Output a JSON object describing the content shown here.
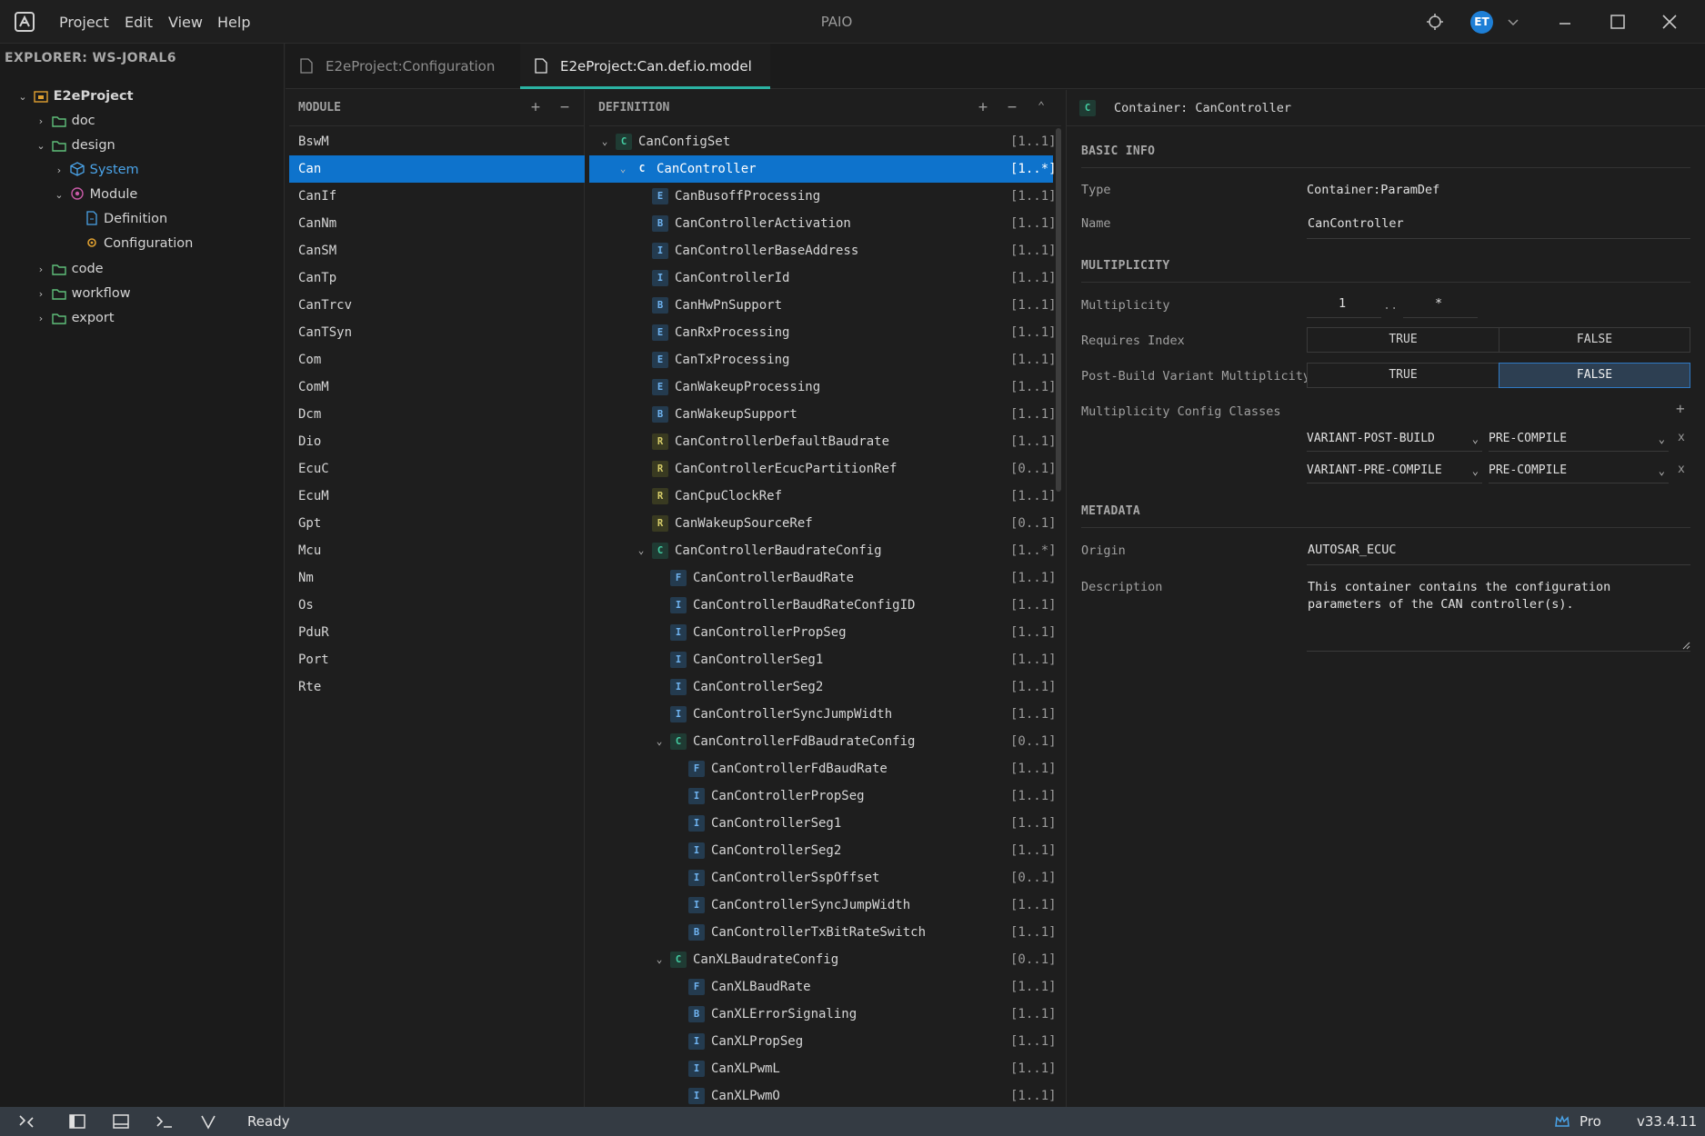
{
  "titlebar": {
    "menu": [
      "Project",
      "Edit",
      "View",
      "Help"
    ],
    "app_title": "PAIO",
    "user_initials": "ET"
  },
  "sidebar": {
    "title": "EXPLORER: WS-JORAL6",
    "items": [
      {
        "label": "E2eProject"
      },
      {
        "label": "doc"
      },
      {
        "label": "design"
      },
      {
        "label": "System"
      },
      {
        "label": "Module"
      },
      {
        "label": "Definition"
      },
      {
        "label": "Configuration"
      },
      {
        "label": "code"
      },
      {
        "label": "workflow"
      },
      {
        "label": "export"
      }
    ]
  },
  "tabs": [
    {
      "label": "E2eProject:Configuration"
    },
    {
      "label": "E2eProject:Can.def.io.model"
    }
  ],
  "module_panel": {
    "title": "MODULE",
    "selected": "Can",
    "items": [
      "BswM",
      "Can",
      "CanIf",
      "CanNm",
      "CanSM",
      "CanTp",
      "CanTrcv",
      "CanTSyn",
      "Com",
      "ComM",
      "Dcm",
      "Dio",
      "EcuC",
      "EcuM",
      "Gpt",
      "Mcu",
      "Nm",
      "Os",
      "PduR",
      "Port",
      "Rte"
    ]
  },
  "definition_panel": {
    "title": "DEFINITION",
    "rows": [
      {
        "type": "C",
        "label": "CanConfigSet",
        "mult": "[1..1]"
      },
      {
        "type": "C",
        "label": "CanController",
        "mult": "[1..*]"
      },
      {
        "type": "E",
        "label": "CanBusoffProcessing",
        "mult": "[1..1]"
      },
      {
        "type": "B",
        "label": "CanControllerActivation",
        "mult": "[1..1]"
      },
      {
        "type": "I",
        "label": "CanControllerBaseAddress",
        "mult": "[1..1]"
      },
      {
        "type": "I",
        "label": "CanControllerId",
        "mult": "[1..1]"
      },
      {
        "type": "B",
        "label": "CanHwPnSupport",
        "mult": "[1..1]"
      },
      {
        "type": "E",
        "label": "CanRxProcessing",
        "mult": "[1..1]"
      },
      {
        "type": "E",
        "label": "CanTxProcessing",
        "mult": "[1..1]"
      },
      {
        "type": "E",
        "label": "CanWakeupProcessing",
        "mult": "[1..1]"
      },
      {
        "type": "B",
        "label": "CanWakeupSupport",
        "mult": "[1..1]"
      },
      {
        "type": "R",
        "label": "CanControllerDefaultBaudrate",
        "mult": "[1..1]"
      },
      {
        "type": "R",
        "label": "CanControllerEcucPartitionRef",
        "mult": "[0..1]"
      },
      {
        "type": "R",
        "label": "CanCpuClockRef",
        "mult": "[1..1]"
      },
      {
        "type": "R",
        "label": "CanWakeupSourceRef",
        "mult": "[0..1]"
      },
      {
        "type": "C",
        "label": "CanControllerBaudrateConfig",
        "mult": "[1..*]"
      },
      {
        "type": "F",
        "label": "CanControllerBaudRate",
        "mult": "[1..1]"
      },
      {
        "type": "I",
        "label": "CanControllerBaudRateConfigID",
        "mult": "[1..1]"
      },
      {
        "type": "I",
        "label": "CanControllerPropSeg",
        "mult": "[1..1]"
      },
      {
        "type": "I",
        "label": "CanControllerSeg1",
        "mult": "[1..1]"
      },
      {
        "type": "I",
        "label": "CanControllerSeg2",
        "mult": "[1..1]"
      },
      {
        "type": "I",
        "label": "CanControllerSyncJumpWidth",
        "mult": "[1..1]"
      },
      {
        "type": "C",
        "label": "CanControllerFdBaudrateConfig",
        "mult": "[0..1]"
      },
      {
        "type": "F",
        "label": "CanControllerFdBaudRate",
        "mult": "[1..1]"
      },
      {
        "type": "I",
        "label": "CanControllerPropSeg",
        "mult": "[1..1]"
      },
      {
        "type": "I",
        "label": "CanControllerSeg1",
        "mult": "[1..1]"
      },
      {
        "type": "I",
        "label": "CanControllerSeg2",
        "mult": "[1..1]"
      },
      {
        "type": "I",
        "label": "CanControllerSspOffset",
        "mult": "[0..1]"
      },
      {
        "type": "I",
        "label": "CanControllerSyncJumpWidth",
        "mult": "[1..1]"
      },
      {
        "type": "B",
        "label": "CanControllerTxBitRateSwitch",
        "mult": "[1..1]"
      },
      {
        "type": "C",
        "label": "CanXLBaudrateConfig",
        "mult": "[0..1]"
      },
      {
        "type": "F",
        "label": "CanXLBaudRate",
        "mult": "[1..1]"
      },
      {
        "type": "B",
        "label": "CanXLErrorSignaling",
        "mult": "[1..1]"
      },
      {
        "type": "I",
        "label": "CanXLPropSeg",
        "mult": "[1..1]"
      },
      {
        "type": "I",
        "label": "CanXLPwmL",
        "mult": "[1..1]"
      },
      {
        "type": "I",
        "label": "CanXLPwmO",
        "mult": "[1..1]"
      }
    ]
  },
  "properties": {
    "badge": "C",
    "header": "Container: CanController",
    "basic_info": {
      "title": "BASIC INFO",
      "type_label": "Type",
      "type_value": "Container:ParamDef",
      "name_label": "Name",
      "name_value": "CanController"
    },
    "multiplicity": {
      "title": "MULTIPLICITY",
      "mult_label": "Multiplicity",
      "lower": "1",
      "sep": "..",
      "upper": "*",
      "req_index_label": "Requires Index",
      "pbv_label": "Post-Build Variant Multiplicity",
      "true_label": "TRUE",
      "false_label": "FALSE",
      "req_index_value": "TRUE",
      "pbv_value": "FALSE",
      "config_classes_label": "Multiplicity Config Classes",
      "classes": [
        {
          "variant": "VARIANT-POST-BUILD",
          "class": "PRE-COMPILE"
        },
        {
          "variant": "VARIANT-PRE-COMPILE",
          "class": "PRE-COMPILE"
        }
      ],
      "remove_label": "x"
    },
    "metadata": {
      "title": "METADATA",
      "origin_label": "Origin",
      "origin_value": "AUTOSAR_ECUC",
      "desc_label": "Description",
      "desc_value": "This container contains the configuration parameters of the CAN controller(s)."
    }
  },
  "statusbar": {
    "status": "Ready",
    "plan": "Pro",
    "version": "v33.4.11"
  },
  "colors": {
    "accent": "#0e73cc",
    "tab_underline": "#2bb3a3",
    "statusbar": "#343b43"
  }
}
